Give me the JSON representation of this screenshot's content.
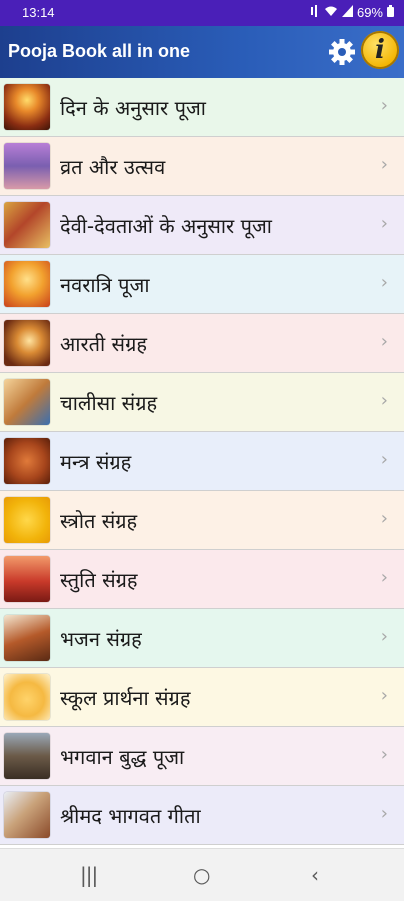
{
  "status": {
    "time": "13:14",
    "battery": "69%",
    "icons": [
      "mute-icon",
      "wifi-icon",
      "signal-icon",
      "battery-icon"
    ]
  },
  "app": {
    "title": "Pooja Book all in one",
    "settings_icon": "gear-icon",
    "info_icon": "info-icon",
    "info_glyph": "i"
  },
  "menu": {
    "items": [
      {
        "label": "दिन के अनुसार पूजा",
        "bg": "#e9f7ea"
      },
      {
        "label": "व्रत और उत्सव",
        "bg": "#fcefe5"
      },
      {
        "label": "देवी-देवताओं के अनुसार पूजा",
        "bg": "#efeaf8"
      },
      {
        "label": "नवरात्रि पूजा",
        "bg": "#e7f3f8"
      },
      {
        "label": "आरती संग्रह",
        "bg": "#fbeaea"
      },
      {
        "label": "चालीसा संग्रह",
        "bg": "#f7f7e4"
      },
      {
        "label": "मन्त्र संग्रह",
        "bg": "#e8eefa"
      },
      {
        "label": "स्त्रोत संग्रह",
        "bg": "#fdf1e6"
      },
      {
        "label": "स्तुति संग्रह",
        "bg": "#fbe9ec"
      },
      {
        "label": "भजन संग्रह",
        "bg": "#e5f7ee"
      },
      {
        "label": "स्कूल प्रार्थना संग्रह",
        "bg": "#fdf8e3"
      },
      {
        "label": "भगवान बुद्ध पूजा",
        "bg": "#f8edf3"
      },
      {
        "label": "श्रीमद भागवत गीता",
        "bg": "#ecebf9"
      }
    ],
    "chevron": "›"
  },
  "nav": {
    "recents": "|||",
    "home": "○",
    "back": "‹"
  }
}
